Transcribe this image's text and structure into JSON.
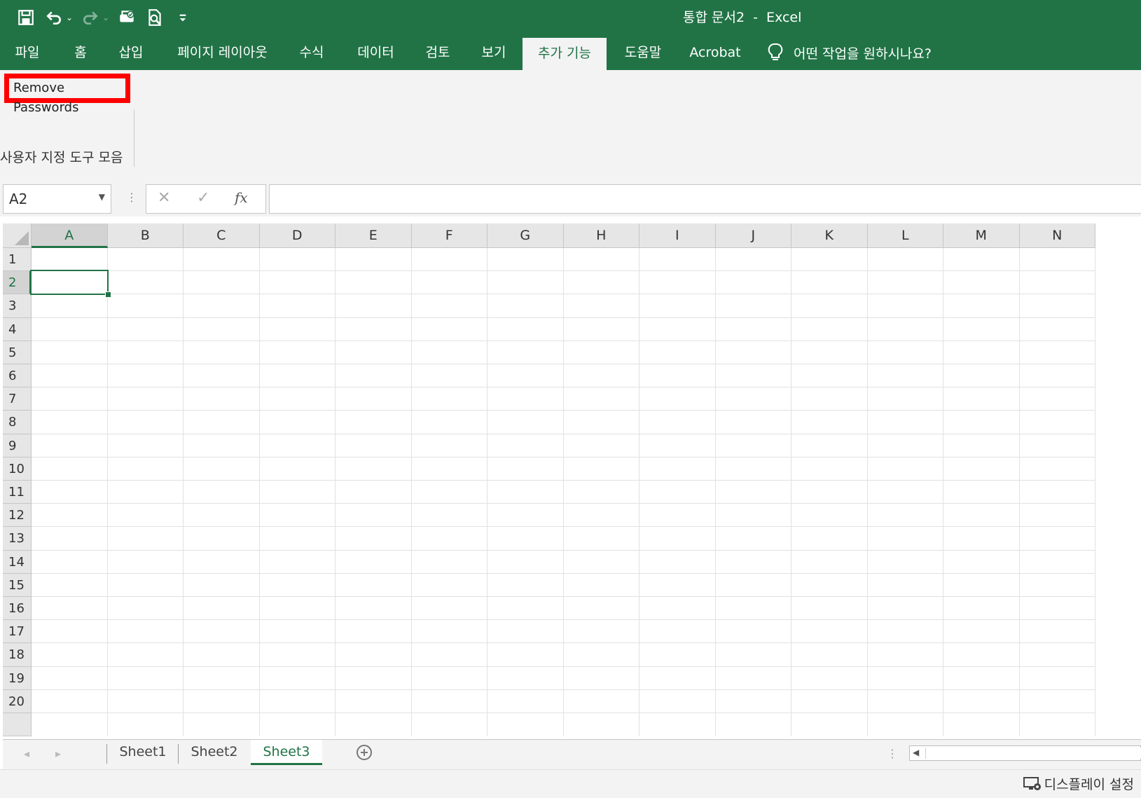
{
  "window": {
    "title": "통합 문서2  -  Excel"
  },
  "quick_access": {
    "icons": [
      "save-icon",
      "undo-icon",
      "redo-icon",
      "touch-mode-icon",
      "print-preview-icon",
      "customize-qat-icon"
    ]
  },
  "ribbon_tabs": [
    {
      "label": "파일",
      "name": "tab-file"
    },
    {
      "label": "홈",
      "name": "tab-home"
    },
    {
      "label": "삽입",
      "name": "tab-insert"
    },
    {
      "label": "페이지 레이아웃",
      "name": "tab-page-layout"
    },
    {
      "label": "수식",
      "name": "tab-formulas"
    },
    {
      "label": "데이터",
      "name": "tab-data"
    },
    {
      "label": "검토",
      "name": "tab-review"
    },
    {
      "label": "보기",
      "name": "tab-view"
    },
    {
      "label": "추가 기능",
      "name": "tab-add-ins",
      "active": true
    },
    {
      "label": "도움말",
      "name": "tab-help"
    },
    {
      "label": "Acrobat",
      "name": "tab-acrobat"
    }
  ],
  "tell_me": {
    "text": "어떤 작업을 원하시나요?",
    "icon": "lightbulb-icon"
  },
  "ribbon": {
    "button_label": "Remove Passwords",
    "group_label": "사용자 지정 도구 모음",
    "highlight_color": "#ff0000"
  },
  "formula_bar": {
    "name_box": "A2",
    "cancel_icon": "✕",
    "enter_icon": "✓",
    "fx_label": "fx",
    "formula": ""
  },
  "grid": {
    "columns": [
      "A",
      "B",
      "C",
      "D",
      "E",
      "F",
      "G",
      "H",
      "I",
      "J",
      "K",
      "L",
      "M",
      "N"
    ],
    "rows": [
      "1",
      "2",
      "3",
      "4",
      "5",
      "6",
      "7",
      "8",
      "9",
      "10",
      "11",
      "12",
      "13",
      "14",
      "15",
      "16",
      "17",
      "18",
      "19",
      "20"
    ],
    "active_cell": "A2"
  },
  "sheets": [
    {
      "label": "Sheet1"
    },
    {
      "label": "Sheet2"
    },
    {
      "label": "Sheet3",
      "active": true
    }
  ],
  "status": {
    "display_settings": "디스플레이 설정"
  },
  "colors": {
    "accent": "#217346",
    "ribbon_bg": "#f3f3f3"
  }
}
